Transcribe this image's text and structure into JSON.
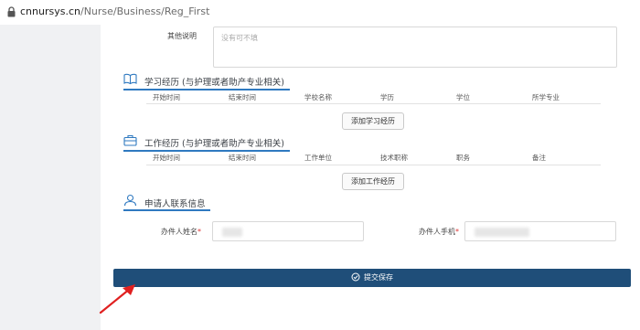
{
  "browser": {
    "url_domain": "cnnursys.cn",
    "url_path": "/Nurse/Business/Reg_First"
  },
  "form": {
    "other_notes": {
      "label": "其他说明",
      "placeholder": "没有可不填"
    },
    "study": {
      "title": "学习经历 (与护理或者助产专业相关)",
      "columns": [
        "开始时间",
        "结束时间",
        "学校名称",
        "学历",
        "学位",
        "所学专业"
      ],
      "add_button": "添加学习经历"
    },
    "work": {
      "title": "工作经历 (与护理或者助产专业相关)",
      "columns": [
        "开始时间",
        "结束时间",
        "工作单位",
        "技术职称",
        "职务",
        "备注"
      ],
      "add_button": "添加工作经历"
    },
    "contact": {
      "title": "申请人联系信息",
      "name_label": "办件人姓名",
      "phone_label": "办件人手机",
      "required_mark": "*"
    },
    "submit_label": "提交保存"
  },
  "colors": {
    "accent": "#2f79c0",
    "submit_bg": "#1f4e79",
    "arrow": "#e02020"
  }
}
